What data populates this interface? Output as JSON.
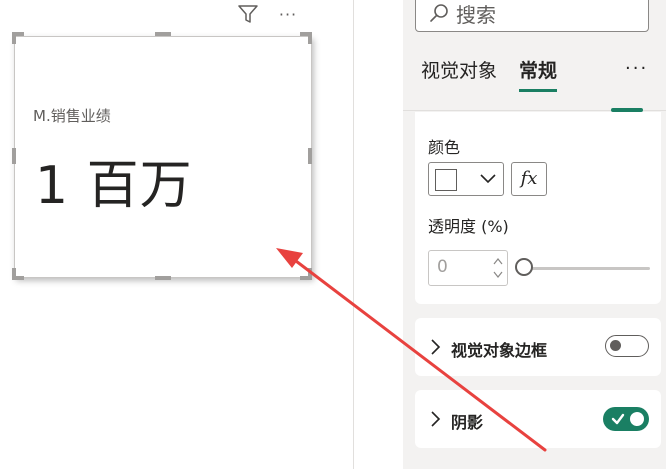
{
  "canvas": {
    "card_label": "M.销售业绩",
    "card_value": "1 百万",
    "header_more": "···"
  },
  "panel": {
    "search_placeholder": "搜索",
    "tabs": [
      {
        "label": "视觉对象"
      },
      {
        "label": "常规",
        "active": true
      }
    ],
    "more": "···",
    "color": {
      "label": "颜色",
      "fx_label": "fx",
      "transparency_label": "透明度 (%)",
      "transparency_value": "0"
    },
    "sections": {
      "border": {
        "label": "视觉对象边框",
        "on": false
      },
      "shadow": {
        "label": "阴影",
        "on": true
      }
    }
  },
  "colors": {
    "accent": "#1a7f63",
    "arrow": "#e8423f"
  }
}
